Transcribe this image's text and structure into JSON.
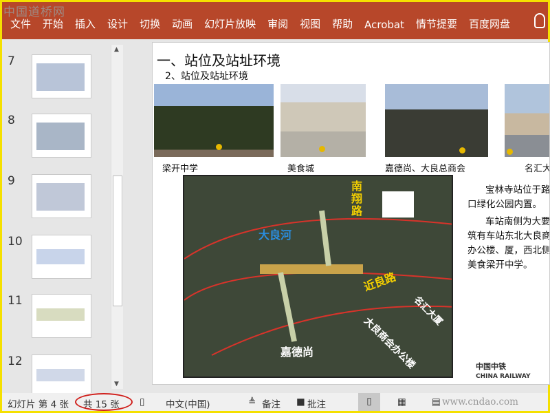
{
  "watermark_top": "中国道桥网",
  "watermark_bottom": "www.cndao.com",
  "ribbon": {
    "tabs": [
      "文件",
      "开始",
      "插入",
      "设计",
      "切换",
      "动画",
      "幻灯片放映",
      "审阅",
      "视图",
      "帮助",
      "Acrobat",
      "情节提要",
      "百度网盘"
    ]
  },
  "thumbnails": [
    {
      "num": "7"
    },
    {
      "num": "8"
    },
    {
      "num": "9"
    },
    {
      "num": "10"
    },
    {
      "num": "11"
    },
    {
      "num": "12"
    }
  ],
  "slide": {
    "title": "一、站位及站址环境",
    "subtitle": "2、站位及站址环境",
    "captions": [
      "梁开中学",
      "美食城",
      "嘉德尚、大良总商会",
      "名汇大"
    ],
    "map_labels": {
      "road1": "南\n翔\n路",
      "river": "大良河",
      "road2": "近良路",
      "jiadeshang": "嘉德尚",
      "office": "大良商会办公楼",
      "tower": "名汇大厦"
    },
    "paragraphs": [
      "宝林寺站位于路路口绿化公园内置。",
      "车站南侧为大要建筑有车站东北大良商会办公楼、厦，西北侧为美食梁开中学。"
    ],
    "logo_text": "中国中铁",
    "logo_sub": "CHINA RAILWAY"
  },
  "status": {
    "slide_pos": "幻灯片 第 4 张",
    "total": "共 15 张",
    "language": "中文(中国)",
    "notes": "备注",
    "comments": "批注"
  }
}
